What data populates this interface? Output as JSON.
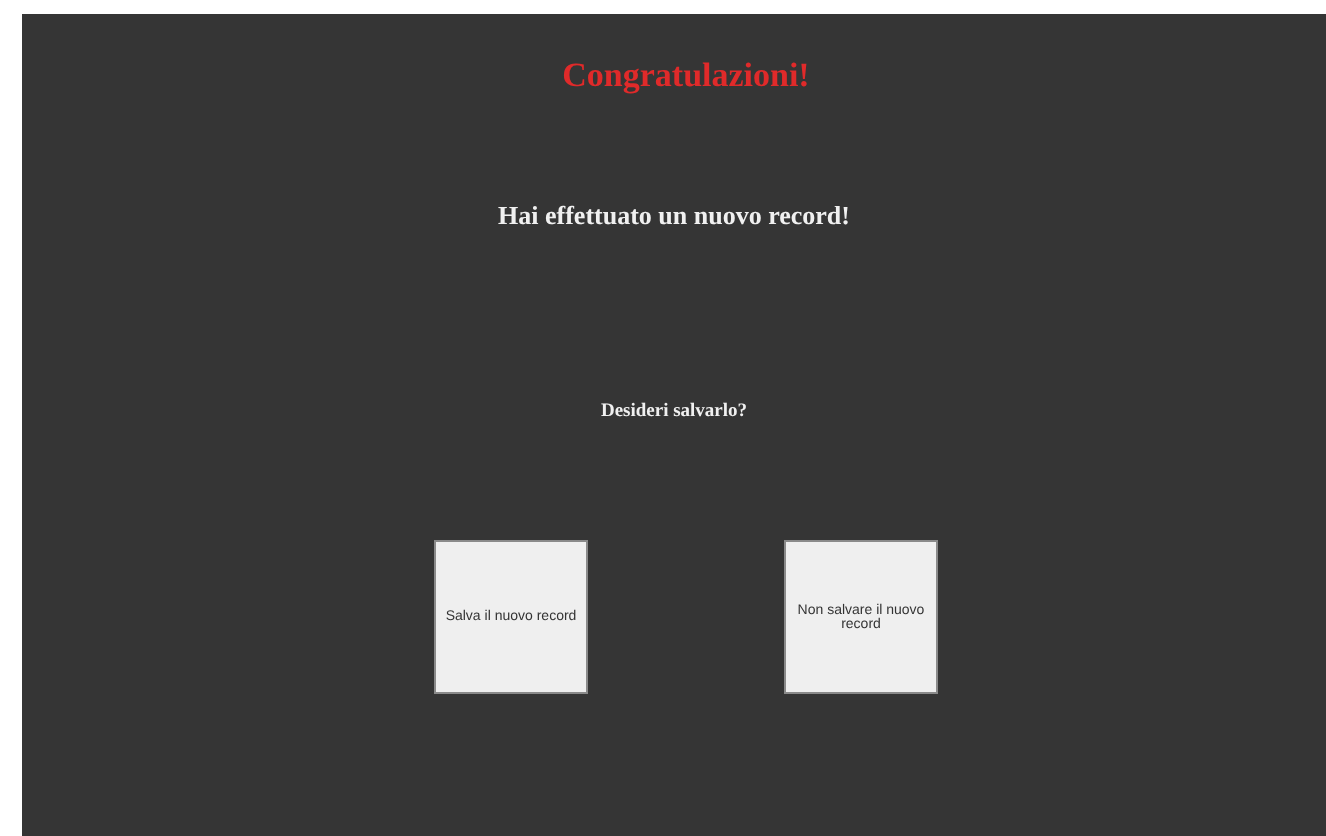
{
  "title": "Congratulazioni!",
  "message": "Hai effettuato un nuovo record!",
  "question": "Desideri salvarlo?",
  "buttons": [
    {
      "label": "Salva il nuovo record"
    },
    {
      "label": "Non salvare il nuovo record"
    }
  ]
}
